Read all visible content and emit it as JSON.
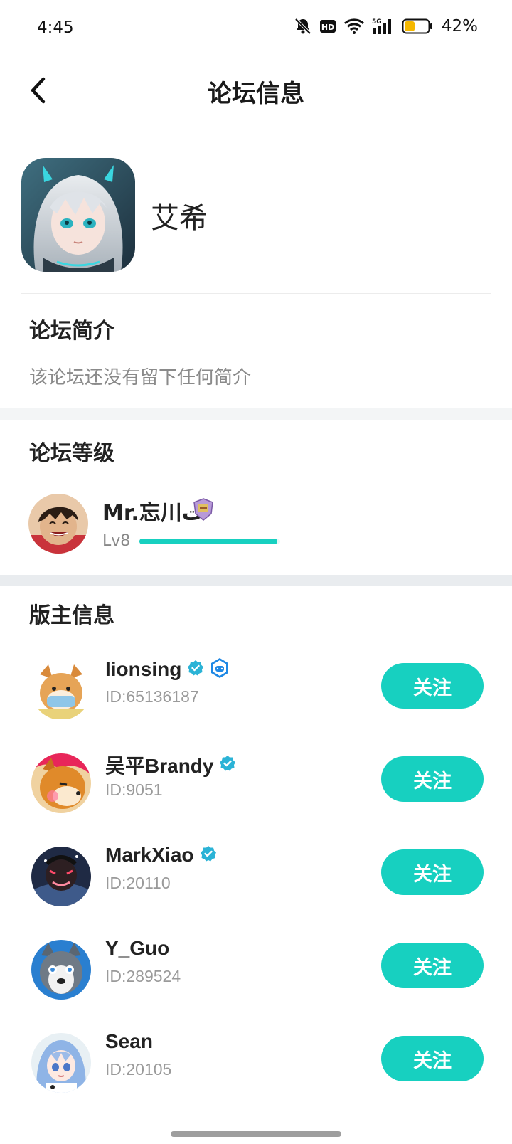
{
  "status_bar": {
    "time": "4:45",
    "battery_percent": "42%",
    "battery_level": 0.42,
    "network_label": "5G",
    "icons": [
      "mute-bell-icon",
      "hd-icon",
      "wifi-icon",
      "signal-icon",
      "battery-icon"
    ]
  },
  "header": {
    "title": "论坛信息",
    "back_icon": "chevron-left-icon"
  },
  "forum": {
    "name": "艾希",
    "avatar": "game-character-avatar"
  },
  "intro": {
    "title": "论坛简介",
    "text": "该论坛还没有留下任何简介"
  },
  "level": {
    "title": "论坛等级",
    "user_name": "Mr.忘川ت",
    "level_label": "Lv8",
    "progress": 0.98,
    "badge_icon": "shield-badge-icon"
  },
  "moderators": {
    "title": "版主信息",
    "follow_label": "关注",
    "items": [
      {
        "name": "lionsing",
        "id": "ID:65136187",
        "verified": true,
        "game_badge": true
      },
      {
        "name": "吴平Brandy",
        "id": "ID:9051",
        "verified": true,
        "game_badge": false
      },
      {
        "name": "MarkXiao",
        "id": "ID:20110",
        "verified": true,
        "game_badge": false
      },
      {
        "name": "Y_Guo",
        "id": "ID:289524",
        "verified": false,
        "game_badge": false
      },
      {
        "name": "Sean",
        "id": "ID:20105",
        "verified": false,
        "game_badge": false
      }
    ]
  },
  "colors": {
    "accent": "#17d0c0",
    "verified_blue": "#2bb3d6",
    "section_band": "#f3f5f6"
  }
}
